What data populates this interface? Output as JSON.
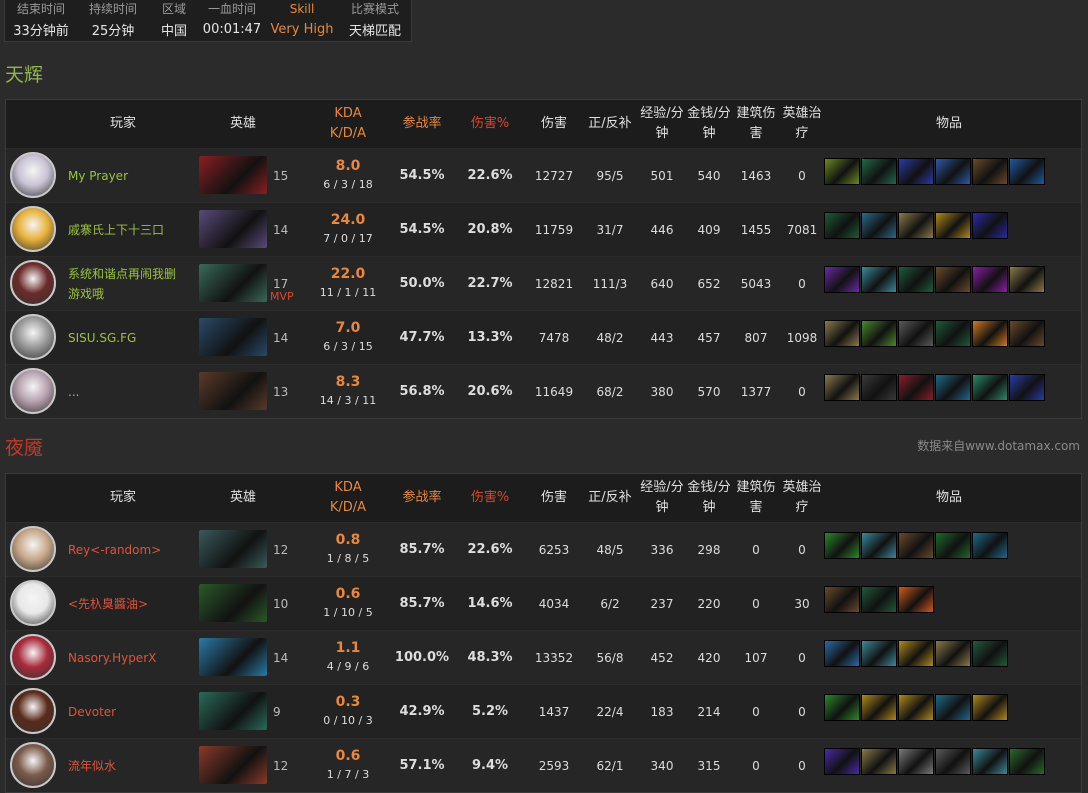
{
  "match_info": {
    "headers": [
      "结束时间",
      "持续时间",
      "区域",
      "一血时间",
      "Skill",
      "比赛模式"
    ],
    "values": [
      "33分钟前",
      "25分钟",
      "中国",
      "00:01:47",
      "Very High",
      "天梯匹配"
    ]
  },
  "radiant": {
    "title": "天辉",
    "players": [
      {
        "name": "My Prayer",
        "level": "15",
        "kda": "8.0",
        "kda_detail": "6 / 3 / 18",
        "participation": "54.5%",
        "damage_pct": "22.6%",
        "damage": "12727",
        "lh_dn": "95/5",
        "xpm": "501",
        "gpm": "540",
        "tower_damage": "1463",
        "healing": "0",
        "mvp": "",
        "avatar_color": "#c9c2d4",
        "hero_color": "#8a1f22",
        "items": [
          "#6a8a1e",
          "#1e6a4a",
          "#2a3aa8",
          "#2a5aa8",
          "#6a4a2a",
          "#1e5aa0"
        ]
      },
      {
        "name": "戚寨氏上下十三口",
        "level": "14",
        "kda": "24.0",
        "kda_detail": "7 / 0 / 17",
        "participation": "54.5%",
        "damage_pct": "20.8%",
        "damage": "11759",
        "lh_dn": "31/7",
        "xpm": "446",
        "gpm": "409",
        "tower_damage": "1455",
        "healing": "7081",
        "mvp": "",
        "avatar_color": "#e8b23a",
        "hero_color": "#5a4a7a",
        "items": [
          "#1e5a3a",
          "#2a6a8a",
          "#8a7a4a",
          "#b08a1a",
          "#2a2aa8"
        ]
      },
      {
        "name": "系统和谐点再闹我删游戏哦",
        "level": "17",
        "kda": "22.0",
        "kda_detail": "11 / 1 / 11",
        "participation": "50.0%",
        "damage_pct": "22.7%",
        "damage": "12821",
        "lh_dn": "111/3",
        "xpm": "640",
        "gpm": "652",
        "tower_damage": "5043",
        "healing": "0",
        "mvp": "MVP",
        "avatar_color": "#6a2a2a",
        "hero_color": "#3a6a5a",
        "items": [
          "#6a2aa8",
          "#3a8a9a",
          "#1e5a3a",
          "#6a4a2a",
          "#8a1ea8",
          "#8a7a4a"
        ]
      },
      {
        "name": "SISU.SG.FG",
        "level": "14",
        "kda": "7.0",
        "kda_detail": "6 / 3 / 15",
        "participation": "47.7%",
        "damage_pct": "13.3%",
        "damage": "7478",
        "lh_dn": "48/2",
        "xpm": "443",
        "gpm": "457",
        "tower_damage": "807",
        "healing": "1098",
        "mvp": "",
        "avatar_color": "#9a9a9a",
        "hero_color": "#2a4a6a",
        "items": [
          "#8a7a4a",
          "#4a8a2a",
          "#5a5a5a",
          "#1e5a3a",
          "#d07a1a",
          "#6a4a2a"
        ]
      },
      {
        "name": "...",
        "level": "13",
        "kda": "8.3",
        "kda_detail": "14 / 3 / 11",
        "participation": "56.8%",
        "damage_pct": "20.6%",
        "damage": "11649",
        "lh_dn": "68/2",
        "xpm": "380",
        "gpm": "570",
        "tower_damage": "1377",
        "healing": "0",
        "mvp": "",
        "avatar_color": "#b8a2b0",
        "hero_color": "#5a3a2a",
        "items": [
          "#8a7a4a",
          "#3a3a3a",
          "#8a1e2a",
          "#1e6a8a",
          "#2a8a6a",
          "#2a3aa8"
        ]
      }
    ]
  },
  "dire": {
    "title": "夜魇",
    "players": [
      {
        "name": "Rey<-random>",
        "level": "12",
        "kda": "0.8",
        "kda_detail": "1 / 8 / 5",
        "participation": "85.7%",
        "damage_pct": "22.6%",
        "damage": "6253",
        "lh_dn": "48/5",
        "xpm": "336",
        "gpm": "298",
        "tower_damage": "0",
        "healing": "0",
        "mvp": "",
        "avatar_color": "#c8a88a",
        "hero_color": "#3a5a5a",
        "items": [
          "#2a8a2a",
          "#3a8a9a",
          "#6a4a2a",
          "#1e6a2a",
          "#1e6a8a"
        ]
      },
      {
        "name": "<先杁臭醬油>",
        "level": "10",
        "kda": "0.6",
        "kda_detail": "1 / 10 / 5",
        "participation": "85.7%",
        "damage_pct": "14.6%",
        "damage": "4034",
        "lh_dn": "6/2",
        "xpm": "237",
        "gpm": "220",
        "tower_damage": "0",
        "healing": "30",
        "mvp": "",
        "avatar_color": "#e8e8e8",
        "hero_color": "#2a5a2a",
        "items": [
          "#6a4a2a",
          "#1e5a3a",
          "#d05a1a"
        ]
      },
      {
        "name": "Nasory.HyperX",
        "level": "14",
        "kda": "1.1",
        "kda_detail": "4 / 9 / 6",
        "participation": "100.0%",
        "damage_pct": "48.3%",
        "damage": "13352",
        "lh_dn": "56/8",
        "xpm": "452",
        "gpm": "420",
        "tower_damage": "107",
        "healing": "0",
        "mvp": "",
        "avatar_color": "#a82a3a",
        "hero_color": "#2a7aa8",
        "items": [
          "#2a6aa8",
          "#3a8a9a",
          "#b08a1a",
          "#8a7a4a",
          "#1e5a3a"
        ]
      },
      {
        "name": "Devoter",
        "level": "9",
        "kda": "0.3",
        "kda_detail": "0 / 10 / 3",
        "participation": "42.9%",
        "damage_pct": "5.2%",
        "damage": "1437",
        "lh_dn": "22/4",
        "xpm": "183",
        "gpm": "214",
        "tower_damage": "0",
        "healing": "0",
        "mvp": "",
        "avatar_color": "#5a2a1a",
        "hero_color": "#2a6a5a",
        "items": [
          "#2a8a2a",
          "#b08a1a",
          "#b08a1a",
          "#1e6a8a",
          "#b08a1a"
        ]
      },
      {
        "name": "流年似水",
        "level": "12",
        "kda": "0.6",
        "kda_detail": "1 / 7 / 3",
        "participation": "57.1%",
        "damage_pct": "9.4%",
        "damage": "2593",
        "lh_dn": "62/1",
        "xpm": "340",
        "gpm": "315",
        "tower_damage": "0",
        "healing": "0",
        "mvp": "",
        "avatar_color": "#7a5a4a",
        "hero_color": "#8a3a2a",
        "items": [
          "#4a2aa8",
          "#8a7a4a",
          "#7a7a7a",
          "#5a5a5a",
          "#3a8a9a",
          "#2a6a2a"
        ]
      }
    ]
  },
  "table_headers": {
    "player": "玩家",
    "hero": "英雄",
    "kda_line1": "KDA",
    "kda_line2": "K/D/A",
    "participation": "参战率",
    "damage_pct": "伤害%",
    "damage": "伤害",
    "lh_dn": "正/反补",
    "xpm": "经验/分钟",
    "gpm": "金钱/分钟",
    "tower_damage": "建筑伤害",
    "healing": "英雄治疗",
    "items": "物品"
  },
  "source_text": "数据来自www.dotamax.com"
}
